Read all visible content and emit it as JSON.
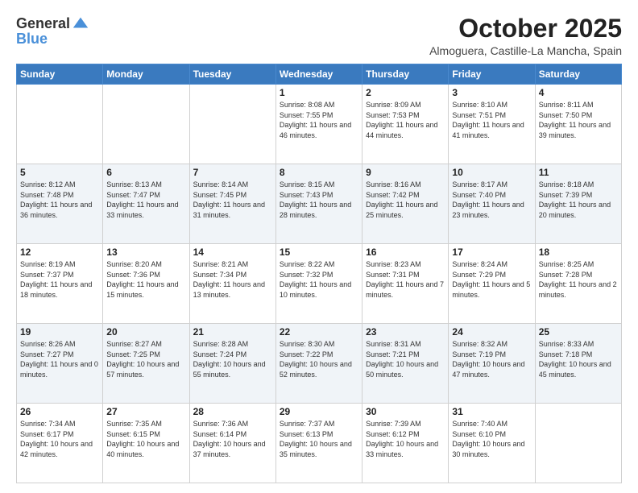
{
  "header": {
    "logo_general": "General",
    "logo_blue": "Blue",
    "month": "October 2025",
    "location": "Almoguera, Castille-La Mancha, Spain"
  },
  "days_of_week": [
    "Sunday",
    "Monday",
    "Tuesday",
    "Wednesday",
    "Thursday",
    "Friday",
    "Saturday"
  ],
  "weeks": [
    [
      {
        "num": "",
        "sunrise": "",
        "sunset": "",
        "daylight": ""
      },
      {
        "num": "",
        "sunrise": "",
        "sunset": "",
        "daylight": ""
      },
      {
        "num": "",
        "sunrise": "",
        "sunset": "",
        "daylight": ""
      },
      {
        "num": "1",
        "sunrise": "Sunrise: 8:08 AM",
        "sunset": "Sunset: 7:55 PM",
        "daylight": "Daylight: 11 hours and 46 minutes."
      },
      {
        "num": "2",
        "sunrise": "Sunrise: 8:09 AM",
        "sunset": "Sunset: 7:53 PM",
        "daylight": "Daylight: 11 hours and 44 minutes."
      },
      {
        "num": "3",
        "sunrise": "Sunrise: 8:10 AM",
        "sunset": "Sunset: 7:51 PM",
        "daylight": "Daylight: 11 hours and 41 minutes."
      },
      {
        "num": "4",
        "sunrise": "Sunrise: 8:11 AM",
        "sunset": "Sunset: 7:50 PM",
        "daylight": "Daylight: 11 hours and 39 minutes."
      }
    ],
    [
      {
        "num": "5",
        "sunrise": "Sunrise: 8:12 AM",
        "sunset": "Sunset: 7:48 PM",
        "daylight": "Daylight: 11 hours and 36 minutes."
      },
      {
        "num": "6",
        "sunrise": "Sunrise: 8:13 AM",
        "sunset": "Sunset: 7:47 PM",
        "daylight": "Daylight: 11 hours and 33 minutes."
      },
      {
        "num": "7",
        "sunrise": "Sunrise: 8:14 AM",
        "sunset": "Sunset: 7:45 PM",
        "daylight": "Daylight: 11 hours and 31 minutes."
      },
      {
        "num": "8",
        "sunrise": "Sunrise: 8:15 AM",
        "sunset": "Sunset: 7:43 PM",
        "daylight": "Daylight: 11 hours and 28 minutes."
      },
      {
        "num": "9",
        "sunrise": "Sunrise: 8:16 AM",
        "sunset": "Sunset: 7:42 PM",
        "daylight": "Daylight: 11 hours and 25 minutes."
      },
      {
        "num": "10",
        "sunrise": "Sunrise: 8:17 AM",
        "sunset": "Sunset: 7:40 PM",
        "daylight": "Daylight: 11 hours and 23 minutes."
      },
      {
        "num": "11",
        "sunrise": "Sunrise: 8:18 AM",
        "sunset": "Sunset: 7:39 PM",
        "daylight": "Daylight: 11 hours and 20 minutes."
      }
    ],
    [
      {
        "num": "12",
        "sunrise": "Sunrise: 8:19 AM",
        "sunset": "Sunset: 7:37 PM",
        "daylight": "Daylight: 11 hours and 18 minutes."
      },
      {
        "num": "13",
        "sunrise": "Sunrise: 8:20 AM",
        "sunset": "Sunset: 7:36 PM",
        "daylight": "Daylight: 11 hours and 15 minutes."
      },
      {
        "num": "14",
        "sunrise": "Sunrise: 8:21 AM",
        "sunset": "Sunset: 7:34 PM",
        "daylight": "Daylight: 11 hours and 13 minutes."
      },
      {
        "num": "15",
        "sunrise": "Sunrise: 8:22 AM",
        "sunset": "Sunset: 7:32 PM",
        "daylight": "Daylight: 11 hours and 10 minutes."
      },
      {
        "num": "16",
        "sunrise": "Sunrise: 8:23 AM",
        "sunset": "Sunset: 7:31 PM",
        "daylight": "Daylight: 11 hours and 7 minutes."
      },
      {
        "num": "17",
        "sunrise": "Sunrise: 8:24 AM",
        "sunset": "Sunset: 7:29 PM",
        "daylight": "Daylight: 11 hours and 5 minutes."
      },
      {
        "num": "18",
        "sunrise": "Sunrise: 8:25 AM",
        "sunset": "Sunset: 7:28 PM",
        "daylight": "Daylight: 11 hours and 2 minutes."
      }
    ],
    [
      {
        "num": "19",
        "sunrise": "Sunrise: 8:26 AM",
        "sunset": "Sunset: 7:27 PM",
        "daylight": "Daylight: 11 hours and 0 minutes."
      },
      {
        "num": "20",
        "sunrise": "Sunrise: 8:27 AM",
        "sunset": "Sunset: 7:25 PM",
        "daylight": "Daylight: 10 hours and 57 minutes."
      },
      {
        "num": "21",
        "sunrise": "Sunrise: 8:28 AM",
        "sunset": "Sunset: 7:24 PM",
        "daylight": "Daylight: 10 hours and 55 minutes."
      },
      {
        "num": "22",
        "sunrise": "Sunrise: 8:30 AM",
        "sunset": "Sunset: 7:22 PM",
        "daylight": "Daylight: 10 hours and 52 minutes."
      },
      {
        "num": "23",
        "sunrise": "Sunrise: 8:31 AM",
        "sunset": "Sunset: 7:21 PM",
        "daylight": "Daylight: 10 hours and 50 minutes."
      },
      {
        "num": "24",
        "sunrise": "Sunrise: 8:32 AM",
        "sunset": "Sunset: 7:19 PM",
        "daylight": "Daylight: 10 hours and 47 minutes."
      },
      {
        "num": "25",
        "sunrise": "Sunrise: 8:33 AM",
        "sunset": "Sunset: 7:18 PM",
        "daylight": "Daylight: 10 hours and 45 minutes."
      }
    ],
    [
      {
        "num": "26",
        "sunrise": "Sunrise: 7:34 AM",
        "sunset": "Sunset: 6:17 PM",
        "daylight": "Daylight: 10 hours and 42 minutes."
      },
      {
        "num": "27",
        "sunrise": "Sunrise: 7:35 AM",
        "sunset": "Sunset: 6:15 PM",
        "daylight": "Daylight: 10 hours and 40 minutes."
      },
      {
        "num": "28",
        "sunrise": "Sunrise: 7:36 AM",
        "sunset": "Sunset: 6:14 PM",
        "daylight": "Daylight: 10 hours and 37 minutes."
      },
      {
        "num": "29",
        "sunrise": "Sunrise: 7:37 AM",
        "sunset": "Sunset: 6:13 PM",
        "daylight": "Daylight: 10 hours and 35 minutes."
      },
      {
        "num": "30",
        "sunrise": "Sunrise: 7:39 AM",
        "sunset": "Sunset: 6:12 PM",
        "daylight": "Daylight: 10 hours and 33 minutes."
      },
      {
        "num": "31",
        "sunrise": "Sunrise: 7:40 AM",
        "sunset": "Sunset: 6:10 PM",
        "daylight": "Daylight: 10 hours and 30 minutes."
      },
      {
        "num": "",
        "sunrise": "",
        "sunset": "",
        "daylight": ""
      }
    ]
  ]
}
